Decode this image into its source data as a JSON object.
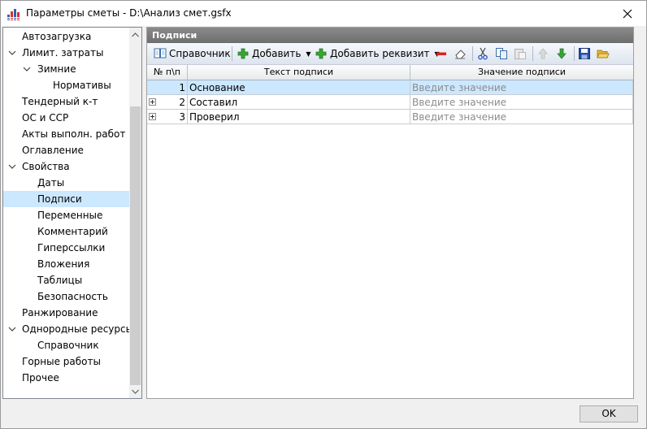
{
  "window": {
    "title": "Параметры сметы - D:\\Анализ смет.gsfx",
    "close_icon": "close-icon"
  },
  "tree": {
    "items": [
      {
        "label": "Автозагрузка",
        "level": 0,
        "expandable": false,
        "selected": false
      },
      {
        "label": "Лимит. затраты",
        "level": 0,
        "expandable": true,
        "selected": false
      },
      {
        "label": "Зимние",
        "level": 1,
        "expandable": true,
        "selected": false
      },
      {
        "label": "Нормативы",
        "level": 2,
        "expandable": false,
        "selected": false
      },
      {
        "label": "Тендерный к-т",
        "level": 0,
        "expandable": false,
        "selected": false
      },
      {
        "label": "ОС и ССР",
        "level": 0,
        "expandable": false,
        "selected": false
      },
      {
        "label": "Акты выполн. работ",
        "level": 0,
        "expandable": false,
        "selected": false
      },
      {
        "label": "Оглавление",
        "level": 0,
        "expandable": false,
        "selected": false
      },
      {
        "label": "Свойства",
        "level": 0,
        "expandable": true,
        "selected": false
      },
      {
        "label": "Даты",
        "level": 1,
        "expandable": false,
        "selected": false
      },
      {
        "label": "Подписи",
        "level": 1,
        "expandable": false,
        "selected": true
      },
      {
        "label": "Переменные",
        "level": 1,
        "expandable": false,
        "selected": false
      },
      {
        "label": "Комментарий",
        "level": 1,
        "expandable": false,
        "selected": false
      },
      {
        "label": "Гиперссылки",
        "level": 1,
        "expandable": false,
        "selected": false
      },
      {
        "label": "Вложения",
        "level": 1,
        "expandable": false,
        "selected": false
      },
      {
        "label": "Таблицы",
        "level": 1,
        "expandable": false,
        "selected": false
      },
      {
        "label": "Безопасность",
        "level": 1,
        "expandable": false,
        "selected": false
      },
      {
        "label": "Ранжирование",
        "level": 0,
        "expandable": false,
        "selected": false
      },
      {
        "label": "Однородные ресурсы",
        "level": 0,
        "expandable": true,
        "selected": false
      },
      {
        "label": "Справочник",
        "level": 1,
        "expandable": false,
        "selected": false
      },
      {
        "label": "Горные работы",
        "level": 0,
        "expandable": false,
        "selected": false
      },
      {
        "label": "Прочее",
        "level": 0,
        "expandable": false,
        "selected": false
      }
    ]
  },
  "panel": {
    "header": "Подписи",
    "toolbar": {
      "reference_label": "Справочник",
      "add_label": "Добавить",
      "add_requisite_label": "Добавить реквизит"
    },
    "columns": [
      "№ п\\п",
      "Текст подписи",
      "Значение подписи"
    ],
    "rows": [
      {
        "num": "1",
        "text": "Основание",
        "value_placeholder": "Введите значение",
        "selected": true,
        "expandable": false
      },
      {
        "num": "2",
        "text": "Составил",
        "value_placeholder": "Введите значение",
        "selected": false,
        "expandable": true
      },
      {
        "num": "3",
        "text": "Проверил",
        "value_placeholder": "Введите значение",
        "selected": false,
        "expandable": true
      }
    ]
  },
  "footer": {
    "ok_label": "OK"
  },
  "colors": {
    "selection": "#cce8ff",
    "panel_header": "#7a7a7a"
  }
}
